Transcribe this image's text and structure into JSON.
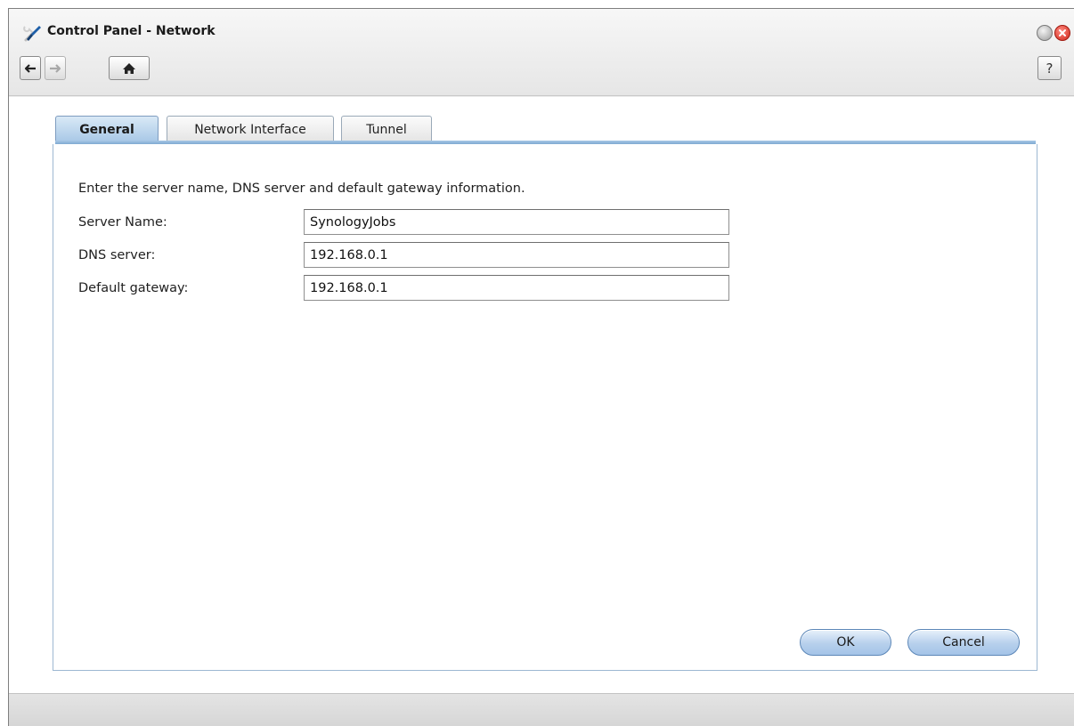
{
  "window": {
    "title": "Control Panel - Network",
    "icon": "control-panel-tools-icon"
  },
  "toolbar": {
    "back_icon": "arrow-left-icon",
    "forward_icon": "arrow-right-icon",
    "home_icon": "home-icon",
    "help_label": "?"
  },
  "tabs": [
    {
      "label": "General",
      "active": true
    },
    {
      "label": "Network Interface",
      "active": false
    },
    {
      "label": "Tunnel",
      "active": false
    }
  ],
  "general": {
    "description": "Enter the server name, DNS server and default gateway information.",
    "fields": [
      {
        "label": "Server Name:",
        "value": "SynologyJobs"
      },
      {
        "label": "DNS server:",
        "value": "192.168.0.1"
      },
      {
        "label": "Default gateway:",
        "value": "192.168.0.1"
      }
    ]
  },
  "buttons": {
    "ok": "OK",
    "cancel": "Cancel"
  },
  "colors": {
    "accent": "#a7c7e6",
    "button_gradient_end": "#a4c4e8",
    "panel_border": "#9db8d2",
    "close_button": "#d0261a"
  }
}
